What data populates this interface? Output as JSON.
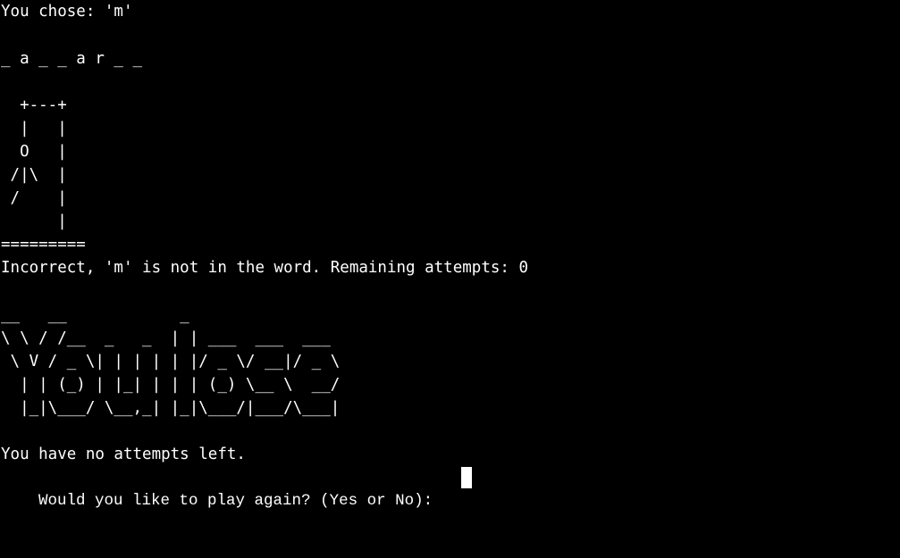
{
  "terminal": {
    "chosen_line": "You chose: 'm'",
    "word_display": "_ a _ _ a r _ _",
    "gallows": [
      "  +---+",
      "  |   |",
      "  O   |",
      " /|\\  |",
      " /    |",
      "      |",
      "========="
    ],
    "feedback_line": "Incorrect, 'm' is not in the word. Remaining attempts: 0",
    "lose_banner": [
      "__   __            _",
      "\\ \\ / /__  _   _  | | ___  ___  ___",
      " \\ V / _ \\| | | | | |/ _ \\/ __|/ _ \\",
      "  | | (_) | |_| | | | (_) \\__ \\  __/",
      "  |_|\\___/ \\__,_| |_|\\___/|___/\\___|"
    ],
    "no_attempts_line": "You have no attempts left.",
    "prompt_text": "Would you like to play again? (Yes or No): ",
    "input_value": ""
  },
  "colors": {
    "background": "#000000",
    "foreground": "#ffffff"
  }
}
